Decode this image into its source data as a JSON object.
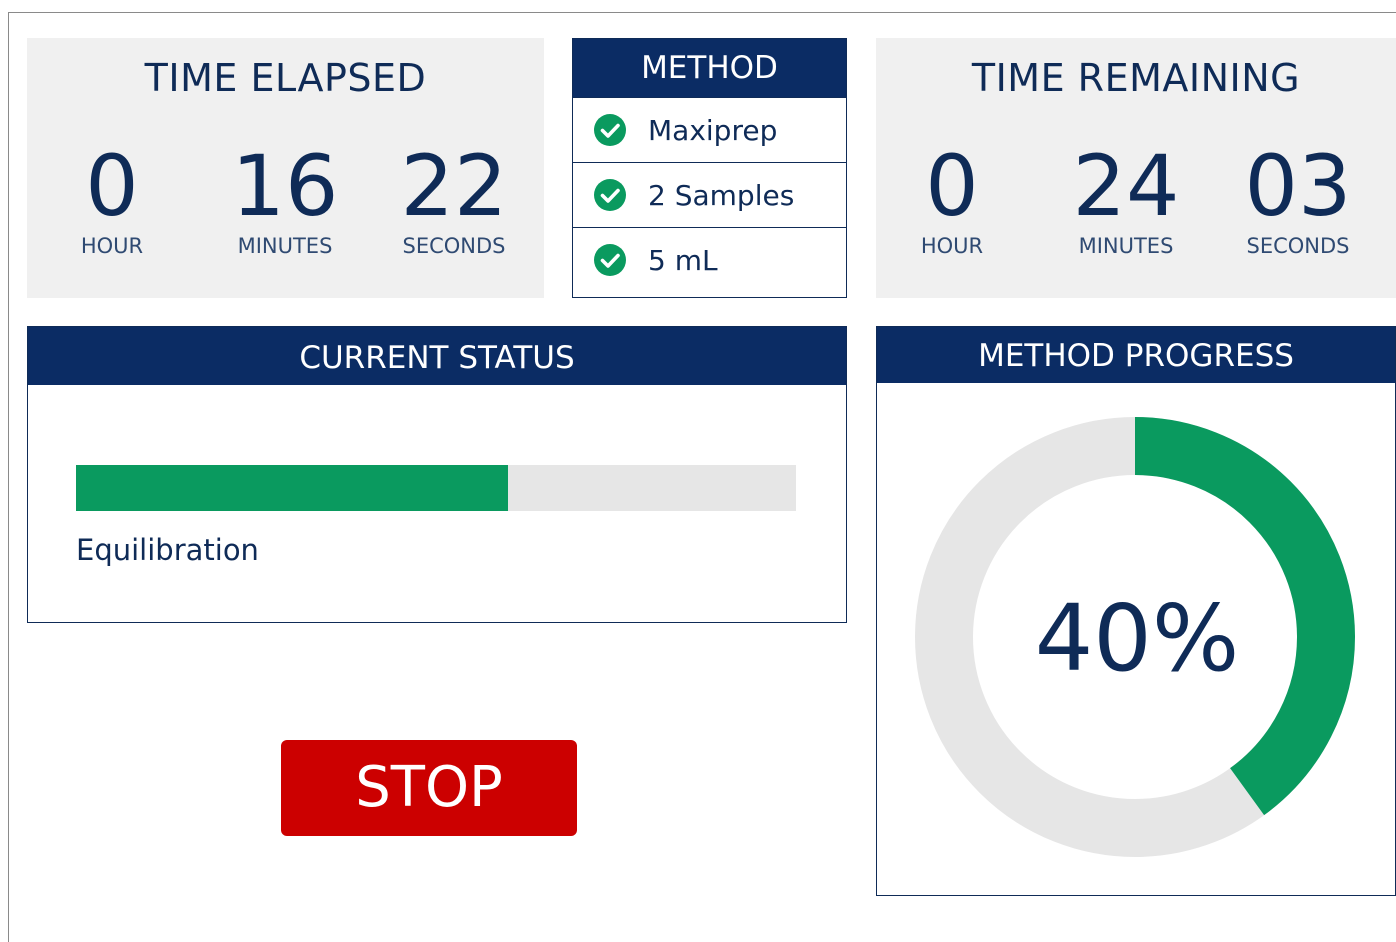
{
  "time_elapsed": {
    "title": "TIME ELAPSED",
    "hour_value": "0",
    "hour_label": "HOUR",
    "minutes_value": "16",
    "minutes_label": "MINUTES",
    "seconds_value": "22",
    "seconds_label": "SECONDS"
  },
  "method": {
    "title": "METHOD",
    "items": [
      {
        "label": "Maxiprep",
        "icon": "check-circle-icon"
      },
      {
        "label": "2 Samples",
        "icon": "check-circle-icon"
      },
      {
        "label": "5 mL",
        "icon": "check-circle-icon"
      }
    ]
  },
  "time_remaining": {
    "title": "TIME REMAINING",
    "hour_value": "0",
    "hour_label": "HOUR",
    "minutes_value": "24",
    "minutes_label": "MINUTES",
    "seconds_value": "03",
    "seconds_label": "SECONDS"
  },
  "current_status": {
    "title": "CURRENT STATUS",
    "step_label": "Equilibration",
    "step_progress_fraction": 0.6
  },
  "stop_button": {
    "label": "STOP"
  },
  "method_progress": {
    "title": "METHOD PROGRESS",
    "percent_text": "40%",
    "fraction": 0.4
  },
  "colors": {
    "navy": "#0b2c64",
    "green": "#0a9a5f",
    "track_gray": "#e6e6e6",
    "panel_gray": "#f0f0f0",
    "stop_red": "#cc0000"
  }
}
